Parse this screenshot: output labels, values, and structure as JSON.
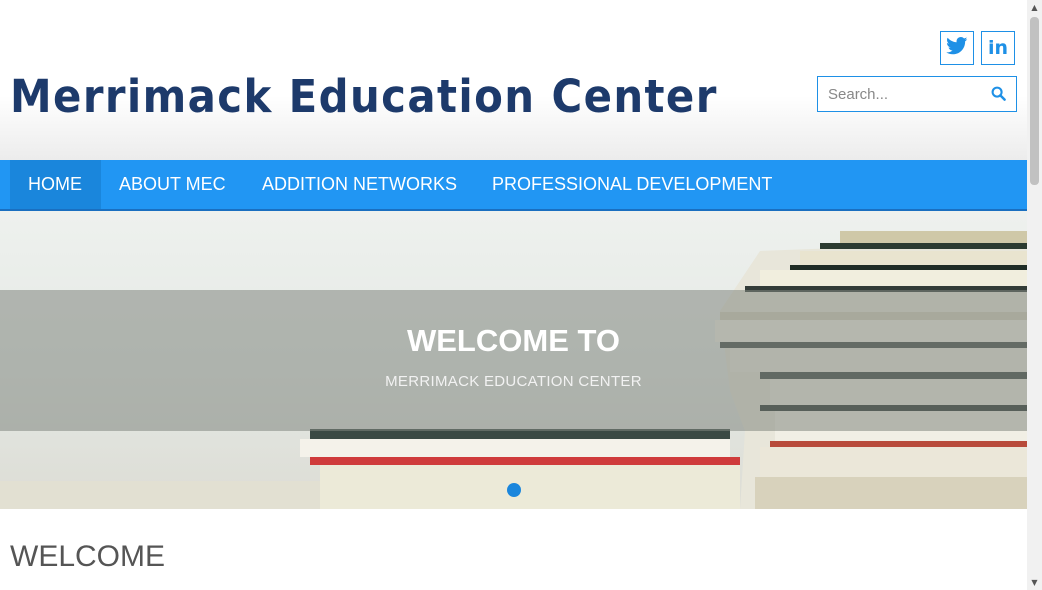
{
  "header": {
    "logo_text": "Merrimack Education Center",
    "social": [
      {
        "name": "twitter",
        "icon": "twitter-icon"
      },
      {
        "name": "linkedin",
        "icon": "linkedin-icon",
        "glyph": "in"
      }
    ],
    "search": {
      "placeholder": "Search...",
      "value": "",
      "icon": "search-icon"
    }
  },
  "nav": {
    "items": [
      {
        "label": "HOME",
        "active": true
      },
      {
        "label": "ABOUT MEC"
      },
      {
        "label": "ADDITION NETWORKS"
      },
      {
        "label": "PROFESSIONAL DEVELOPMENT"
      }
    ]
  },
  "hero": {
    "title": "WELCOME TO",
    "subtitle": "MERRIMACK EDUCATION CENTER",
    "slide_count": 1,
    "active_slide": 1
  },
  "content": {
    "heading": "WELCOME"
  },
  "colors": {
    "brand": "#1d3a6b",
    "accent": "#2196f3",
    "nav_active": "#1a86dc"
  }
}
